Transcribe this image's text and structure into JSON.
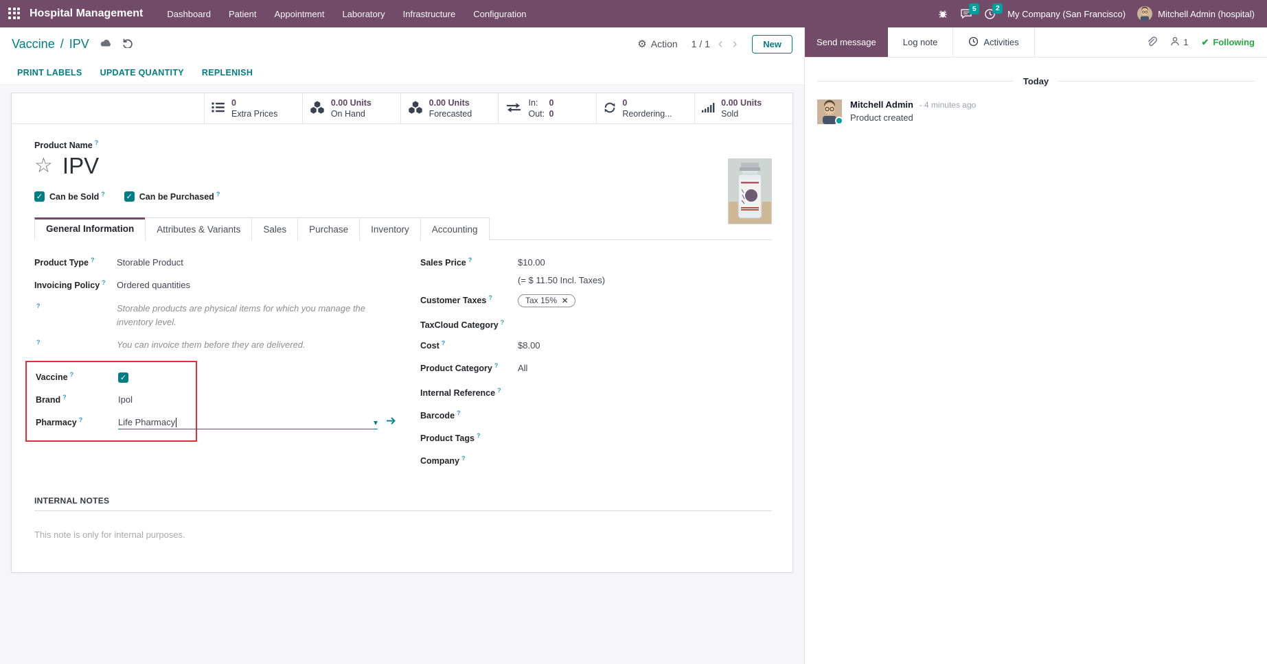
{
  "help_marker": "?",
  "colors": {
    "brand_purple": "#714B67",
    "accent_teal": "#017E84",
    "badge_teal": "#00A09D",
    "following_green": "#28a745",
    "annotation_red": "#dc2f38"
  },
  "icons": {
    "gear": "⚙",
    "chevron_left": "‹",
    "chevron_right": "›",
    "star": "☆",
    "check": "✓",
    "following_check": "✔",
    "caret_down": "▾",
    "remove": "✕"
  },
  "navbar": {
    "brand": "Hospital Management",
    "menus": [
      "Dashboard",
      "Patient",
      "Appointment",
      "Laboratory",
      "Infrastructure",
      "Configuration"
    ],
    "messages_badge": "5",
    "activities_badge": "2",
    "company": "My Company (San Francisco)",
    "user": "Mitchell Admin (hospital)"
  },
  "breadcrumb": {
    "parent": "Vaccine",
    "separator": "/",
    "current": "IPV"
  },
  "control_panel": {
    "action": "Action",
    "pager": "1 / 1",
    "new": "New"
  },
  "header_buttons": {
    "print_labels": "PRINT LABELS",
    "update_quantity": "UPDATE QUANTITY",
    "replenish": "REPLENISH"
  },
  "stat_buttons": [
    {
      "value": "0",
      "label": "Extra Prices"
    },
    {
      "value": "0.00 Units",
      "label": "On Hand"
    },
    {
      "value": "0.00 Units",
      "label": "Forecasted"
    },
    {
      "in_label": "In:",
      "in_value": "0",
      "out_label": "Out:",
      "out_value": "0"
    },
    {
      "value": "0",
      "label": "Reordering..."
    },
    {
      "value": "0.00 Units",
      "label": "Sold"
    }
  ],
  "form": {
    "product_name_label": "Product Name",
    "product_name": "IPV",
    "can_be_sold": "Can be Sold",
    "can_be_purchased": "Can be Purchased",
    "tabs": [
      "General Information",
      "Attributes & Variants",
      "Sales",
      "Purchase",
      "Inventory",
      "Accounting"
    ],
    "left": {
      "product_type_label": "Product Type",
      "product_type": "Storable Product",
      "invoicing_policy_label": "Invoicing Policy",
      "invoicing_policy": "Ordered quantities",
      "help1": "Storable products are physical items for which you manage the inventory level.",
      "help2": "You can invoice them before they are delivered.",
      "vaccine_label": "Vaccine",
      "brand_label": "Brand",
      "brand": "Ipol",
      "pharmacy_label": "Pharmacy",
      "pharmacy": "Life Pharmacy"
    },
    "right": {
      "sales_price_label": "Sales Price",
      "sales_price": "$10.00",
      "sales_price_note": "(= $ 11.50 Incl. Taxes)",
      "customer_taxes_label": "Customer Taxes",
      "customer_tax": "Tax 15%",
      "taxcloud_label": "TaxCloud Category",
      "cost_label": "Cost",
      "cost": "$8.00",
      "product_category_label": "Product Category",
      "product_category": "All",
      "internal_reference_label": "Internal Reference",
      "barcode_label": "Barcode",
      "product_tags_label": "Product Tags",
      "company_label": "Company"
    },
    "notes": {
      "header": "INTERNAL NOTES",
      "placeholder": "This note is only for internal purposes."
    }
  },
  "chatter": {
    "send_message": "Send message",
    "log_note": "Log note",
    "activities": "Activities",
    "followers": "1",
    "following": "Following",
    "today": "Today",
    "message": {
      "author": "Mitchell Admin",
      "time": "- 4 minutes ago",
      "body": "Product created"
    }
  }
}
